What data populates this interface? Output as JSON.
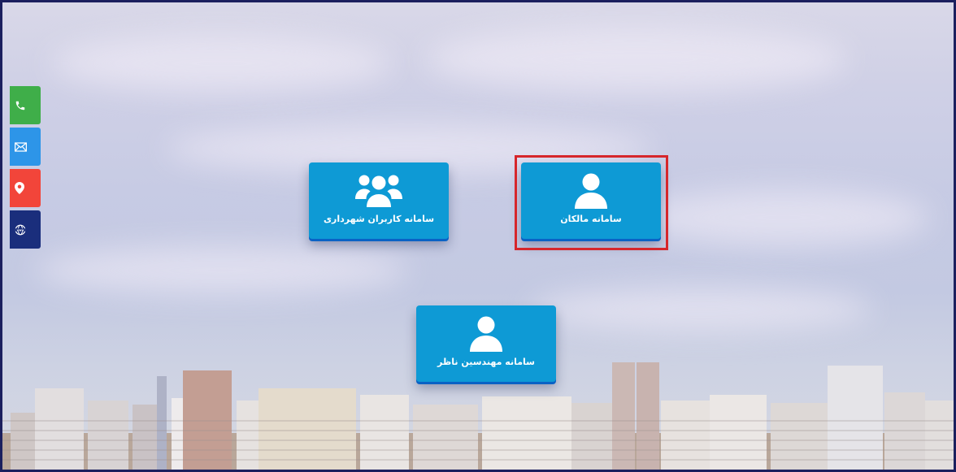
{
  "colors": {
    "tile_blue": "#0e9ad5",
    "tile_shadow": "#0a62c5",
    "highlight_red": "#d6262b",
    "phone_green": "#3fae49",
    "mail_blue": "#2d95e8",
    "location_red": "#f2453a",
    "web_navy": "#1a2e7c"
  },
  "side_bar": {
    "items": [
      {
        "name": "phone",
        "icon": "phone-icon"
      },
      {
        "name": "email",
        "icon": "mail-icon"
      },
      {
        "name": "location",
        "icon": "location-pin-icon"
      },
      {
        "name": "website",
        "icon": "www-globe-icon"
      }
    ]
  },
  "tiles": {
    "municipality_users": {
      "label": "سامانه کاربران شهرداری",
      "icon": "users-group-icon"
    },
    "owners": {
      "label": "سامانه مالکان",
      "icon": "user-icon",
      "highlighted": true
    },
    "supervising_engineers": {
      "label": "سامانه مهندسین ناظر",
      "icon": "user-icon"
    }
  }
}
